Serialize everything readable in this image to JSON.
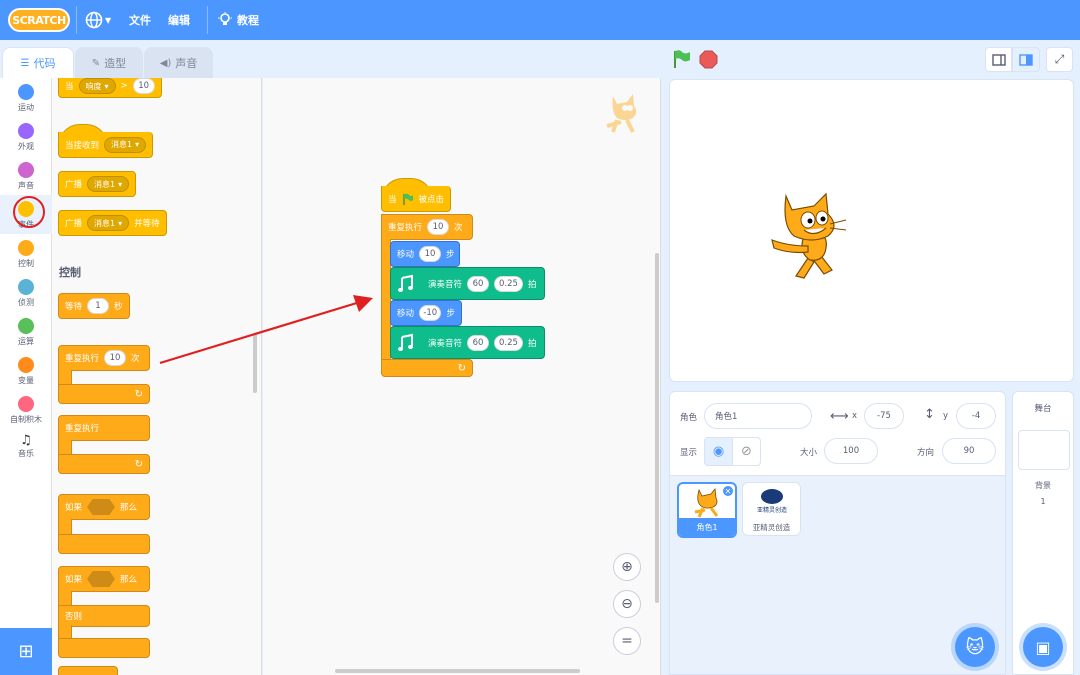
{
  "menubar": {
    "logo": "SCRATCH",
    "file": "文件",
    "edit": "编辑",
    "tutorials": "教程"
  },
  "tabs": {
    "code": "代码",
    "costumes": "造型",
    "sounds": "声音"
  },
  "categories": [
    {
      "label": "运动",
      "color": "#4c97ff"
    },
    {
      "label": "外观",
      "color": "#9966ff"
    },
    {
      "label": "声音",
      "color": "#cf63cf"
    },
    {
      "label": "事件",
      "color": "#ffbf00"
    },
    {
      "label": "控制",
      "color": "#ffab19"
    },
    {
      "label": "侦测",
      "color": "#5cb1d6"
    },
    {
      "label": "运算",
      "color": "#59c059"
    },
    {
      "label": "变量",
      "color": "#ff8c1a"
    },
    {
      "label": "自制积木",
      "color": "#ff6680"
    },
    {
      "label": "音乐",
      "icon": "music-note-icon"
    }
  ],
  "palette": {
    "when_loudness": {
      "when": "当",
      "sensor": "响度",
      "op": ">",
      "value": "10"
    },
    "when_receive": {
      "label": "当接收到",
      "msg": "消息1"
    },
    "broadcast": {
      "label": "广播",
      "msg": "消息1"
    },
    "broadcast_wait": {
      "label": "广播",
      "msg": "消息1",
      "suffix": "并等待"
    },
    "control_heading": "控制",
    "wait": {
      "label": "等待",
      "value": "1",
      "suffix": "秒"
    },
    "repeat": {
      "label": "重复执行",
      "value": "10",
      "suffix": "次"
    },
    "forever": {
      "label": "重复执行"
    },
    "if_then": {
      "if": "如果",
      "then": "那么"
    },
    "if_else": {
      "if": "如果",
      "then": "那么",
      "else": "否则"
    }
  },
  "script": {
    "hat": {
      "when": "当",
      "clicked": "被点击"
    },
    "repeat": {
      "label": "重复执行",
      "value": "10",
      "suffix": "次"
    },
    "move1": {
      "label": "移动",
      "value": "10",
      "suffix": "步"
    },
    "note1": {
      "label": "演奏音符",
      "note": "60",
      "beats": "0.25",
      "suffix": "拍"
    },
    "move2": {
      "label": "移动",
      "value": "-10",
      "suffix": "步"
    },
    "note2": {
      "label": "演奏音符",
      "note": "60",
      "beats": "0.25",
      "suffix": "拍"
    }
  },
  "sprite_info": {
    "sprite_label": "角色",
    "sprite_name": "角色1",
    "x_label": "x",
    "x": "-75",
    "y_label": "y",
    "y": "-4",
    "show_label": "显示",
    "size_label": "大小",
    "size": "100",
    "direction_label": "方向",
    "direction": "90"
  },
  "sprites": [
    {
      "name": "角色1",
      "selected": true
    },
    {
      "name": "亚精灵创造",
      "logo_text": "亚精灵创造"
    }
  ],
  "stage_pane": {
    "title": "舞台",
    "backdrops_label": "背景",
    "backdrops_count": "1"
  }
}
